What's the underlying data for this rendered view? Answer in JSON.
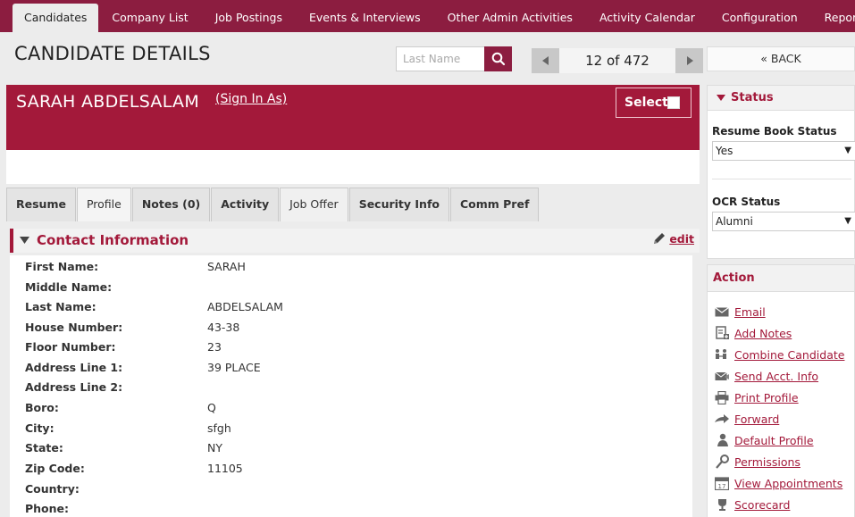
{
  "nav": {
    "items": [
      "Candidates",
      "Company List",
      "Job Postings",
      "Events & Interviews",
      "Other Admin Activities",
      "Activity Calendar",
      "Configuration",
      "Reports"
    ]
  },
  "header": {
    "title": "CANDIDATE DETAILS",
    "search_placeholder": "Last Name",
    "pager_text": "12 of 472",
    "back_label": "« BACK"
  },
  "candidate": {
    "name": "SARAH ABDELSALAM",
    "sign_in_label": "(Sign In As)",
    "select_label": "Select"
  },
  "tabs": [
    "Resume",
    "Profile",
    "Notes (0)",
    "Activity",
    "Job Offer",
    "Security Info",
    "Comm Pref"
  ],
  "contact": {
    "title": "Contact Information",
    "edit_label": "edit",
    "fields": [
      {
        "label": "First Name:",
        "value": "SARAH"
      },
      {
        "label": "Middle Name:",
        "value": ""
      },
      {
        "label": "Last Name:",
        "value": "ABDELSALAM"
      },
      {
        "label": "House Number:",
        "value": "43-38"
      },
      {
        "label": "Floor Number:",
        "value": "23"
      },
      {
        "label": "Address Line 1:",
        "value": "39 PLACE"
      },
      {
        "label": "Address Line 2:",
        "value": ""
      },
      {
        "label": "Boro:",
        "value": "Q"
      },
      {
        "label": "City:",
        "value": "sfgh"
      },
      {
        "label": "State:",
        "value": "NY"
      },
      {
        "label": "Zip Code:",
        "value": "11105"
      },
      {
        "label": "Country:",
        "value": ""
      },
      {
        "label": "Phone:",
        "value": ""
      }
    ]
  },
  "status_panel": {
    "title": "Status",
    "resume_book_label": "Resume Book Status",
    "resume_book_value": "Yes",
    "ocr_label": "OCR Status",
    "ocr_value": "Alumni"
  },
  "action_panel": {
    "title": "Action",
    "items": [
      {
        "label": "Email",
        "icon": "email-icon"
      },
      {
        "label": "Add Notes",
        "icon": "add-notes-icon"
      },
      {
        "label": "Combine Candidate",
        "icon": "combine-icon"
      },
      {
        "label": "Send Acct. Info",
        "icon": "send-icon"
      },
      {
        "label": "Print Profile",
        "icon": "print-icon"
      },
      {
        "label": "Forward",
        "icon": "forward-icon"
      },
      {
        "label": "Default Profile",
        "icon": "user-icon"
      },
      {
        "label": "Permissions",
        "icon": "key-icon"
      },
      {
        "label": "View Appointments",
        "icon": "calendar-icon"
      },
      {
        "label": "Scorecard",
        "icon": "trophy-icon"
      }
    ]
  },
  "colors": {
    "brand": "#a3193a",
    "nav": "#8c1d40"
  }
}
